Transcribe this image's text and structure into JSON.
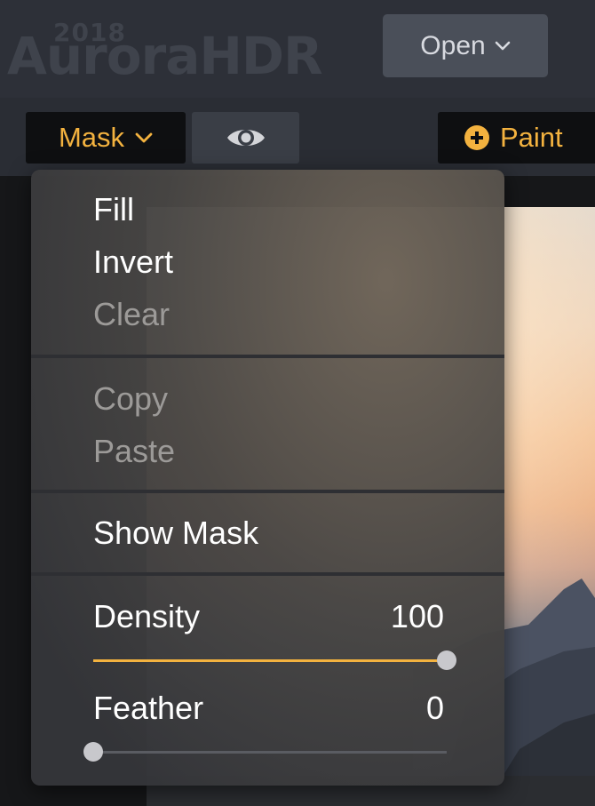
{
  "header": {
    "logo_year": "2018",
    "logo_word": "AuroraHDR",
    "open_label": "Open"
  },
  "toolbar": {
    "mask_label": "Mask",
    "paint_label": "Paint"
  },
  "menu": {
    "group1": [
      "Fill",
      "Invert",
      "Clear"
    ],
    "group2": [
      "Copy",
      "Paste"
    ],
    "show_mask": "Show Mask",
    "density": {
      "label": "Density",
      "value": "100",
      "fraction": 1.0
    },
    "feather": {
      "label": "Feather",
      "value": "0",
      "fraction": 0.0
    }
  },
  "colors": {
    "accent": "#f3b23f",
    "menu_text_enabled": "#ffffff",
    "menu_text_disabled": "#9c9a98"
  },
  "icons": {
    "mask_chevron": "chevron-down-icon",
    "open_chevron": "chevron-down-icon",
    "eye": "eye-icon",
    "paint": "plus-circle-icon"
  }
}
